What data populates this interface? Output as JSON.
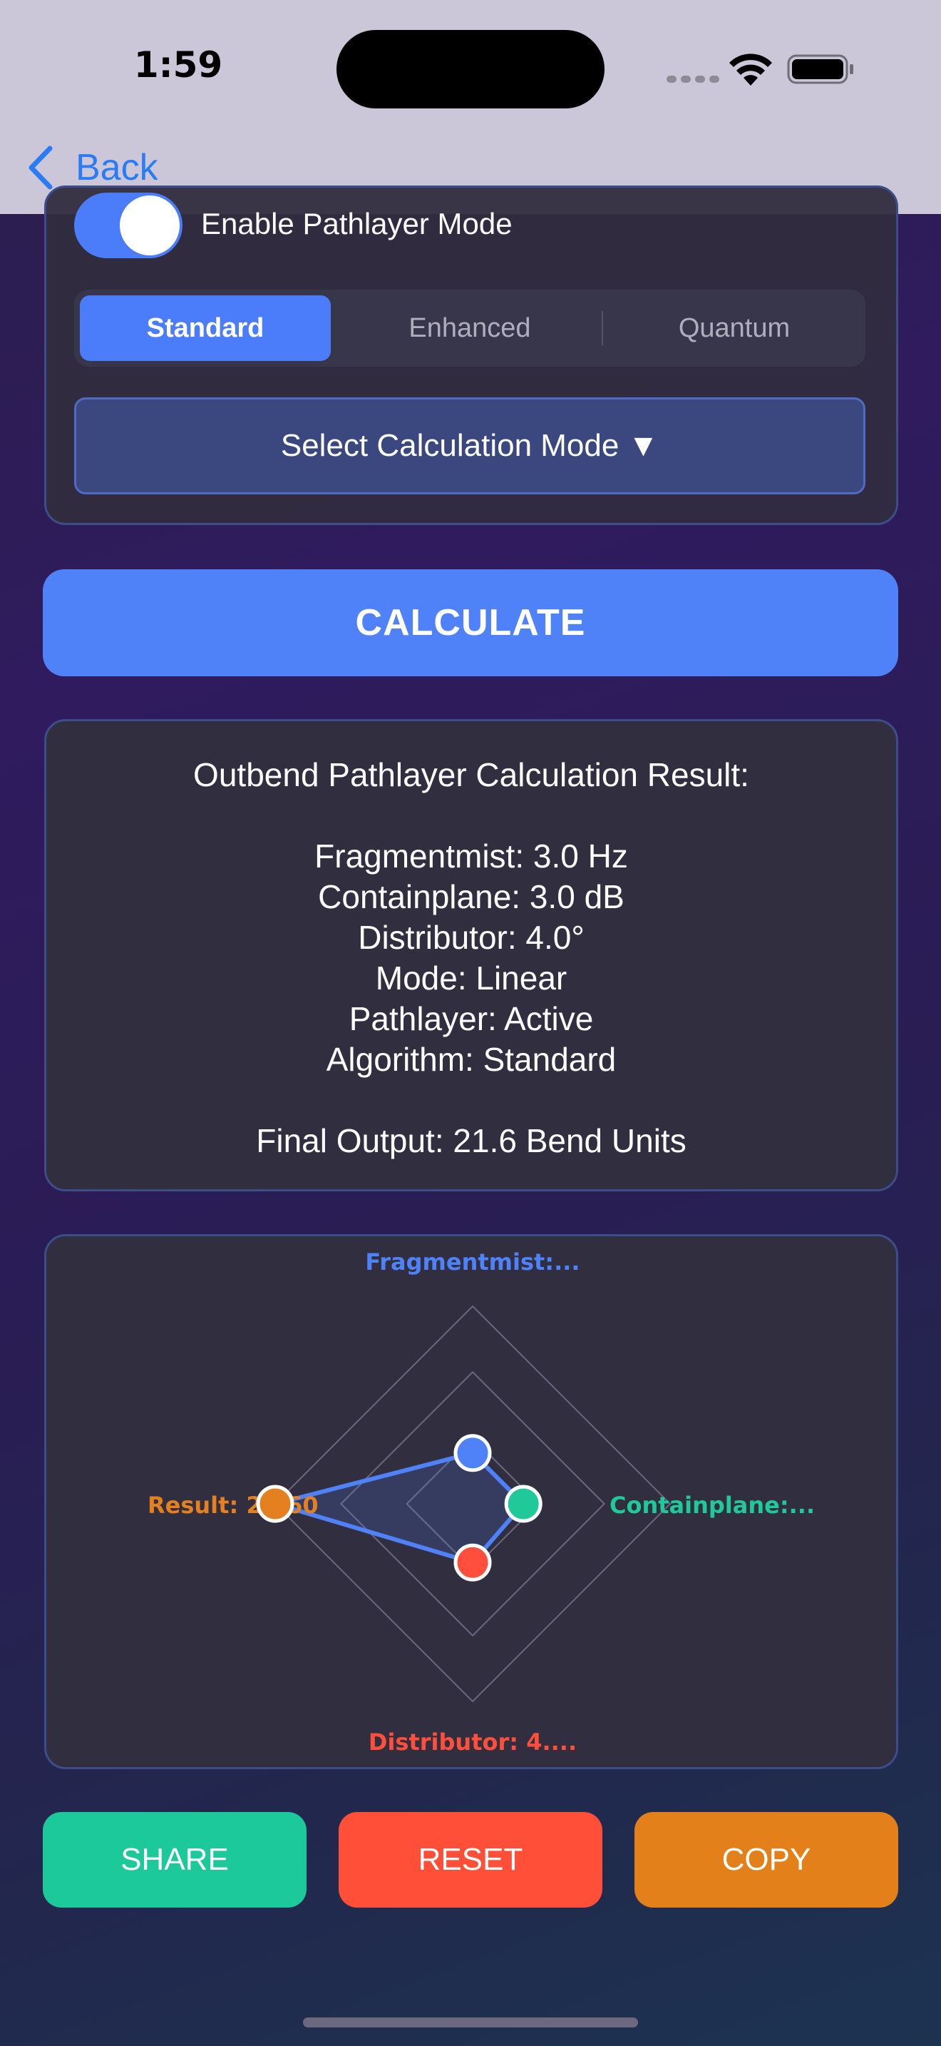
{
  "status_bar": {
    "time": "1:59"
  },
  "nav": {
    "back_label": "Back"
  },
  "settings": {
    "toggle_label": "Enable Pathlayer Mode",
    "toggle_on": true,
    "segments": [
      "Standard",
      "Enhanced",
      "Quantum"
    ],
    "selected_segment": "Standard",
    "mode_select_label": "Select Calculation Mode ▼"
  },
  "calculate_label": "CALCULATE",
  "result": {
    "title": "Outbend Pathlayer Calculation Result:",
    "lines": [
      "Fragmentmist: 3.0 Hz",
      "Containplane: 3.0 dB",
      "Distributor: 4.0°",
      "Mode: Linear",
      "Pathlayer: Active",
      "Algorithm: Standard"
    ],
    "final_output": "Final Output: 21.6 Bend Units"
  },
  "chart_data": {
    "type": "radar",
    "axes": [
      {
        "label": "Fragmentmist:...",
        "color": "#4f81f9",
        "value": 3.0
      },
      {
        "label": "Containplane:...",
        "color": "#1fc99a",
        "value": 3.0
      },
      {
        "label": "Distributor: 4....",
        "color": "#ff4f3c",
        "value": 4.0
      },
      {
        "label": "Result: 21.60",
        "color": "#e4801f",
        "value": 21.6
      }
    ],
    "max": 21.6,
    "rings": 3
  },
  "actions": [
    {
      "label": "SHARE",
      "color": "#1cc99a"
    },
    {
      "label": "RESET",
      "color": "#ff4f38"
    },
    {
      "label": "COPY",
      "color": "#e4801a"
    }
  ]
}
